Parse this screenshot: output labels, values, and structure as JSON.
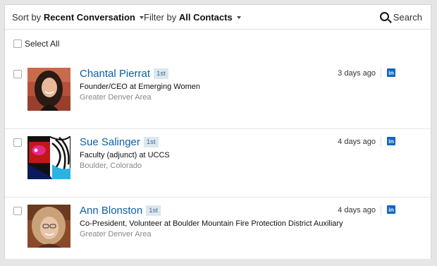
{
  "toolbar": {
    "sort_prefix": "Sort by",
    "sort_value": "Recent Conversation",
    "filter_prefix": "Filter by",
    "filter_value": "All Contacts",
    "search_label": "Search"
  },
  "select_all_label": "Select All",
  "contacts": [
    {
      "name": "Chantal Pierrat",
      "degree": "1st",
      "title": "Founder/CEO at Emerging Women",
      "location": "Greater Denver Area",
      "last_contact": "3 days ago",
      "network_icon": "linkedin-icon"
    },
    {
      "name": "Sue Salinger",
      "degree": "1st",
      "title": "Faculty (adjunct) at UCCS",
      "location": "Boulder, Colorado",
      "last_contact": "4 days ago",
      "network_icon": "linkedin-icon"
    },
    {
      "name": "Ann Blonston",
      "degree": "1st",
      "title": "Co-President, Volunteer at Boulder Mountain Fire Protection District Auxiliary",
      "location": "Greater Denver Area",
      "last_contact": "4 days ago",
      "network_icon": "linkedin-icon"
    }
  ],
  "colors": {
    "name_link": "#0a5fa8",
    "badge_bg": "#dbe7ef",
    "linkedin_blue": "#0b66c2"
  }
}
